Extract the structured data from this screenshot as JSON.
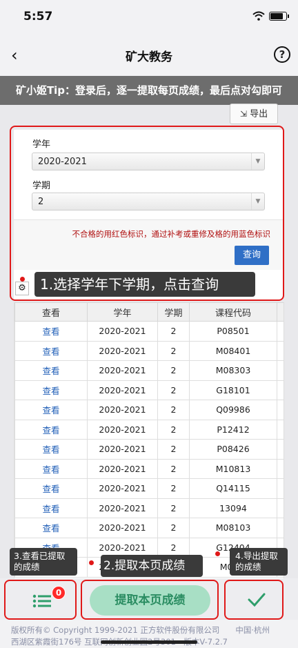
{
  "status_bar": {
    "time": "5:57"
  },
  "nav": {
    "back": "‹",
    "title": "矿大教务",
    "help": "?"
  },
  "tip_banner": "矿小姬Tip：登录后，逐一提取每页成绩，最后点对勾即可",
  "export_button": "导出",
  "form": {
    "year_label": "学年",
    "year_value": "2020-2021",
    "term_label": "学期",
    "term_value": "2",
    "notice": "不合格的用红色标识，通过补考或重修及格的用蓝色标识",
    "query_button": "查询"
  },
  "annotations": {
    "step1": "1.选择学年下学期，点击查询",
    "step2": "2.提取本页成绩",
    "step3": "3.查看已提取的成绩",
    "step4": "4.导出提取的成绩"
  },
  "table": {
    "headers": [
      "查看",
      "学年",
      "学期",
      "课程代码"
    ],
    "rows": [
      [
        "查看",
        "2020-2021",
        "2",
        "P08501"
      ],
      [
        "查看",
        "2020-2021",
        "2",
        "M08401"
      ],
      [
        "查看",
        "2020-2021",
        "2",
        "M08303"
      ],
      [
        "查看",
        "2020-2021",
        "2",
        "G18101"
      ],
      [
        "查看",
        "2020-2021",
        "2",
        "Q09986"
      ],
      [
        "查看",
        "2020-2021",
        "2",
        "P12412"
      ],
      [
        "查看",
        "2020-2021",
        "2",
        "P08426"
      ],
      [
        "查看",
        "2020-2021",
        "2",
        "M10813"
      ],
      [
        "查看",
        "2020-2021",
        "2",
        "Q14115"
      ],
      [
        "查看",
        "2020-2021",
        "2",
        "13094"
      ],
      [
        "查看",
        "2020-2021",
        "2",
        "M08103"
      ],
      [
        "查看",
        "2020-2021",
        "2",
        "G12404"
      ],
      [
        "查看",
        "2020-2021",
        "2",
        "M08..."
      ]
    ]
  },
  "bottom": {
    "badge_count": "0",
    "extract_button": "提取本页成绩"
  },
  "footer": {
    "line1": "版权所有© Copyright 1999-2021 正方软件股份有限公司　　中国·杭州",
    "line2": "西湖区紫霞街176号 互联网创新创业园2号301　版本V-7.2.7"
  },
  "colors": {
    "accent_red": "#e01818",
    "query_blue": "#2f6fc6",
    "extract_green": "#a8dfc5"
  }
}
